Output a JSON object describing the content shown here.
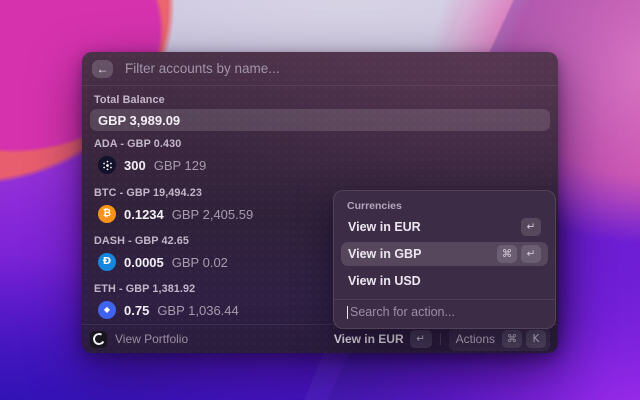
{
  "header": {
    "back_icon": "←",
    "filter_placeholder": "Filter accounts by name..."
  },
  "list": {
    "total_label": "Total Balance",
    "total_value": "GBP 3,989.09",
    "accounts": [
      {
        "symbol": "ADA",
        "header": "ADA - GBP 0.430",
        "amount": "300",
        "fiat": "GBP 129",
        "color": "#12122a",
        "icon": "ada-icon"
      },
      {
        "symbol": "BTC",
        "header": "BTC - GBP 19,494.23",
        "amount": "0.1234",
        "fiat": "GBP 2,405.59",
        "color": "#f7931a",
        "glyph": "₿",
        "icon": "btc-icon"
      },
      {
        "symbol": "DASH",
        "header": "DASH - GBP 42.65",
        "amount": "0.0005",
        "fiat": "GBP 0.02",
        "color": "#1587dd",
        "glyph": "Đ",
        "icon": "dash-icon"
      },
      {
        "symbol": "ETH",
        "header": "ETH - GBP 1,381.92",
        "amount": "0.75",
        "fiat": "GBP 1,036.44",
        "color": "#3f63ec",
        "glyph": "◆",
        "icon": "eth-icon"
      }
    ]
  },
  "popup": {
    "title": "Currencies",
    "items": [
      {
        "label": "View in EUR",
        "keys": [
          "↵"
        ]
      },
      {
        "label": "View in GBP",
        "keys": [
          "⌘",
          "↵"
        ],
        "selected": true
      },
      {
        "label": "View in USD",
        "keys": []
      }
    ],
    "selected_item": "View in GBP",
    "search_placeholder": "Search for action..."
  },
  "footer": {
    "app_label": "View Portfolio",
    "primary_action": "View in EUR",
    "primary_key": "↵",
    "actions_label": "Actions",
    "command_key": "⌘",
    "k_key": "K"
  },
  "colors": {
    "selection_highlight": "rgba(255,255,255,0.13)",
    "btc": "#f7931a",
    "dash": "#1587dd",
    "eth": "#3f63ec",
    "ada": "#12122a"
  }
}
